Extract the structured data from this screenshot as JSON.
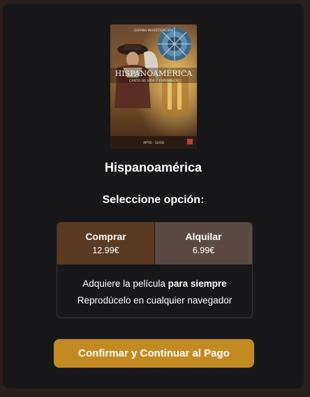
{
  "movie": {
    "title": "Hispanoamérica",
    "poster": {
      "top_text": "ESPAÑA·INVESTIGACIÓN",
      "title_text": "HISPANOAMÉRICA",
      "tagline": "CANTO DE VIDA Y ESPERANZA",
      "rating": "APTO · 12/16"
    }
  },
  "selector": {
    "heading": "Seleccione opción:",
    "options": [
      {
        "label": "Comprar",
        "price": "12.99€"
      },
      {
        "label": "Alquilar",
        "price": "6.99€"
      }
    ],
    "description": {
      "line1_prefix": "Adquiere la película ",
      "line1_bold": "para siempre",
      "line2": "Reprodúcelo en cualquier navegador"
    }
  },
  "confirm_label": "Confirmar y Continuar al Pago",
  "colors": {
    "background": "#2a201d",
    "modal": "#17171a",
    "buy_selected": "#5a3b22",
    "rent": "#5b4a44",
    "accent": "#c48a22"
  }
}
